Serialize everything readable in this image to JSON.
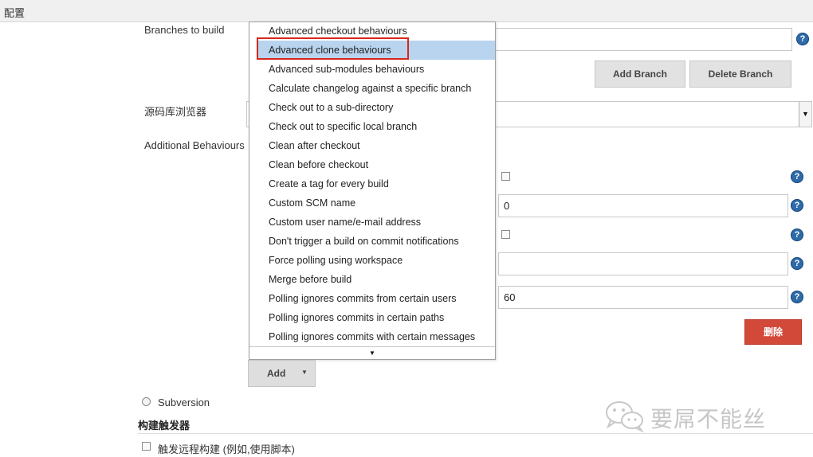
{
  "header": {
    "title": "配置"
  },
  "labels": {
    "branches_to_build": "Branches to build",
    "repo_browser": "源码库浏览器",
    "additional_behaviours": "Additional Behaviours"
  },
  "buttons": {
    "add_branch": "Add Branch",
    "delete_branch": "Delete Branch",
    "add": "Add",
    "delete": "删除"
  },
  "fields": {
    "field_1_value": "0",
    "field_2_value": "",
    "field_3_value": "60"
  },
  "dropdown": {
    "items": [
      "Advanced checkout behaviours",
      "Advanced clone behaviours",
      "Advanced sub-modules behaviours",
      "Calculate changelog against a specific branch",
      "Check out to a sub-directory",
      "Check out to specific local branch",
      "Clean after checkout",
      "Clean before checkout",
      "Create a tag for every build",
      "Custom SCM name",
      "Custom user name/e-mail address",
      "Don't trigger a build on commit notifications",
      "Force polling using workspace",
      "Merge before build",
      "Polling ignores commits from certain users",
      "Polling ignores commits in certain paths",
      "Polling ignores commits with certain messages"
    ],
    "selected_index": 1
  },
  "scm": {
    "subversion_label": "Subversion"
  },
  "triggers": {
    "title": "构建触发器",
    "remote_build_label": "触发远程构建 (例如,使用脚本)"
  },
  "watermark": {
    "text": "要屌不能丝"
  },
  "help_glyph": "?",
  "icons": {
    "help": "help-icon",
    "dropdown_arrow": "chevron-down-icon"
  },
  "colors": {
    "delete_button": "#d24939",
    "selected_item": "#b8d4ef",
    "highlight_border": "#d9261c",
    "help_icon": "#2e6aa8"
  }
}
